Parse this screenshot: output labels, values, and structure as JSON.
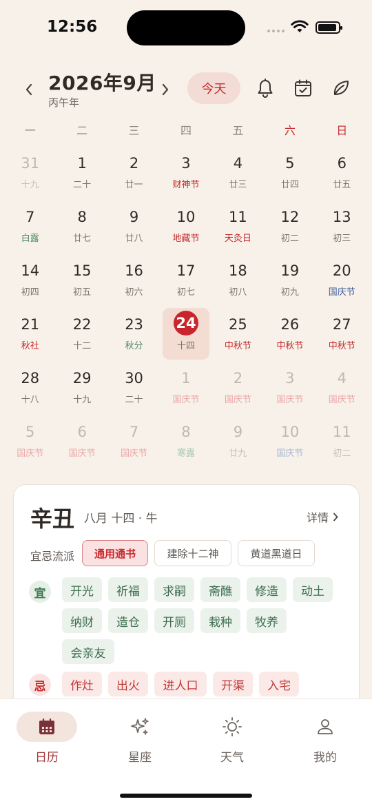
{
  "status": {
    "time": "12:56"
  },
  "header": {
    "month_title": "2026年9月",
    "ganzhi_year": "丙午年",
    "today_label": "今天"
  },
  "icons": {
    "prev": "chevron-left-icon",
    "next": "chevron-right-icon",
    "bell": "bell-icon",
    "calendar_check": "calendar-check-icon",
    "leaf": "leaf-icon"
  },
  "weekdays": [
    "一",
    "二",
    "三",
    "四",
    "五",
    "六",
    "日"
  ],
  "weekday_colors": {
    "六": "#c72a2c",
    "日": "#c72a2c"
  },
  "calendar": {
    "days": [
      {
        "n": "31",
        "s": "十九",
        "dim": true
      },
      {
        "n": "1",
        "s": "二十"
      },
      {
        "n": "2",
        "s": "廿一"
      },
      {
        "n": "3",
        "s": "财神节",
        "c": "red"
      },
      {
        "n": "4",
        "s": "廿三"
      },
      {
        "n": "5",
        "s": "廿四"
      },
      {
        "n": "6",
        "s": "廿五"
      },
      {
        "n": "7",
        "s": "白露",
        "c": "green"
      },
      {
        "n": "8",
        "s": "廿七"
      },
      {
        "n": "9",
        "s": "廿八"
      },
      {
        "n": "10",
        "s": "地藏节",
        "c": "red"
      },
      {
        "n": "11",
        "s": "天灸日",
        "c": "red"
      },
      {
        "n": "12",
        "s": "初二"
      },
      {
        "n": "13",
        "s": "初三"
      },
      {
        "n": "14",
        "s": "初四"
      },
      {
        "n": "15",
        "s": "初五"
      },
      {
        "n": "16",
        "s": "初六"
      },
      {
        "n": "17",
        "s": "初七"
      },
      {
        "n": "18",
        "s": "初八"
      },
      {
        "n": "19",
        "s": "初九"
      },
      {
        "n": "20",
        "s": "国庆节",
        "c": "blue"
      },
      {
        "n": "21",
        "s": "秋社",
        "c": "red"
      },
      {
        "n": "22",
        "s": "十二"
      },
      {
        "n": "23",
        "s": "秋分",
        "c": "green"
      },
      {
        "n": "24",
        "s": "十四",
        "selected": true
      },
      {
        "n": "25",
        "s": "中秋节",
        "c": "red"
      },
      {
        "n": "26",
        "s": "中秋节",
        "c": "red"
      },
      {
        "n": "27",
        "s": "中秋节",
        "c": "red"
      },
      {
        "n": "28",
        "s": "十八"
      },
      {
        "n": "29",
        "s": "十九"
      },
      {
        "n": "30",
        "s": "二十"
      },
      {
        "n": "1",
        "s": "国庆节",
        "c": "red",
        "dim": true
      },
      {
        "n": "2",
        "s": "国庆节",
        "c": "red",
        "dim": true
      },
      {
        "n": "3",
        "s": "国庆节",
        "c": "red",
        "dim": true
      },
      {
        "n": "4",
        "s": "国庆节",
        "c": "red",
        "dim": true
      },
      {
        "n": "5",
        "s": "国庆节",
        "c": "red",
        "dim": true
      },
      {
        "n": "6",
        "s": "国庆节",
        "c": "red",
        "dim": true
      },
      {
        "n": "7",
        "s": "国庆节",
        "c": "red",
        "dim": true
      },
      {
        "n": "8",
        "s": "寒露",
        "c": "green",
        "dim": true
      },
      {
        "n": "9",
        "s": "廿九",
        "dim": true
      },
      {
        "n": "10",
        "s": "国庆节",
        "c": "blue",
        "dim": true
      },
      {
        "n": "11",
        "s": "初二",
        "dim": true
      }
    ]
  },
  "detail": {
    "day_ganzhi": "辛丑",
    "lunar": "八月 十四 · 牛",
    "more_label": "详情",
    "school_label": "宜忌流派",
    "schools": [
      "通用通书",
      "建除十二神",
      "黄道黑道日"
    ],
    "yi_label": "宜",
    "ji_label": "忌",
    "yi": [
      "开光",
      "祈福",
      "求嗣",
      "斋醮",
      "修造",
      "动土",
      "纳财",
      "造仓",
      "开厕",
      "栽种",
      "牧养",
      "会亲友"
    ],
    "ji": [
      "作灶",
      "出火",
      "进人口",
      "开渠",
      "入宅"
    ]
  },
  "tabs": [
    {
      "label": "日历",
      "icon": "calendar-icon",
      "active": true
    },
    {
      "label": "星座",
      "icon": "sparkles-icon"
    },
    {
      "label": "天气",
      "icon": "sun-icon"
    },
    {
      "label": "我的",
      "icon": "person-icon"
    }
  ],
  "colors": {
    "accent_red": "#c72a2c",
    "background": "#f8f1ea",
    "yi_green": "#3e7a52"
  }
}
